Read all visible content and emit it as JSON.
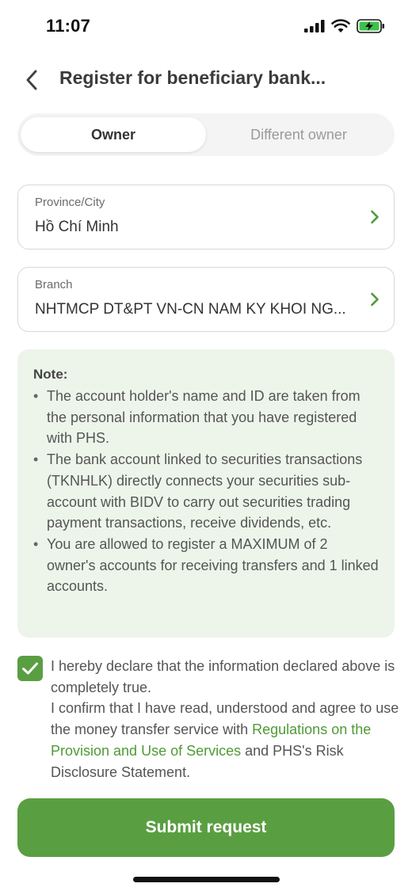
{
  "status_bar": {
    "time": "11:07"
  },
  "header": {
    "title": "Register for beneficiary bank..."
  },
  "tabs": [
    {
      "label": "Owner",
      "active": true
    },
    {
      "label": "Different owner",
      "active": false
    }
  ],
  "province": {
    "label": "Province/City",
    "value": "Hồ Chí Minh"
  },
  "branch": {
    "label": "Branch",
    "value": "NHTMCP DT&PT VN-CN NAM KY KHOI NG..."
  },
  "note": {
    "title": "Note:",
    "items": [
      "The account holder's name and ID are taken from the personal information that you have registered with PHS.",
      "The bank account linked to securities transactions (TKNHLK) directly connects your securities sub-account with BIDV to carry out securities trading payment transactions, receive dividends, etc.",
      "You are allowed to register a MAXIMUM of 2 owner's accounts for receiving transfers and 1 linked accounts."
    ]
  },
  "declaration": {
    "checked": true,
    "line1": "I hereby declare that the information declared above is completely true.",
    "line2": "I confirm that I have read, understood and agree to use the money transfer service with",
    "link": "Regulations on the Provision and Use of Services",
    "line3": "and PHS's Risk Disclosure Statement."
  },
  "submit_label": "Submit request",
  "colors": {
    "accent": "#5a9e42",
    "note_bg": "#edf5ea",
    "link": "#4f9a35"
  }
}
